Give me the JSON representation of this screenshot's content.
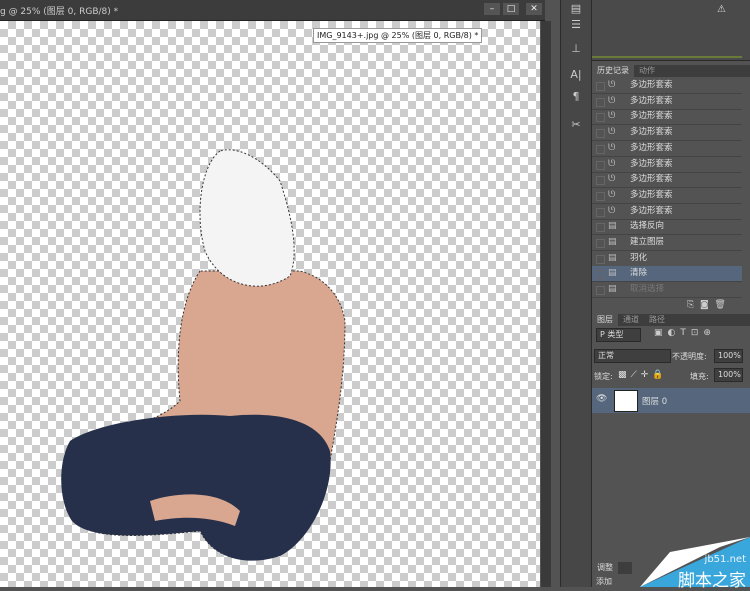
{
  "window": {
    "title": "g @ 25% (图层 0, RGB/8) *",
    "tooltip": "IMG_9143+.jpg @ 25% (图层 0, RGB/8) *",
    "min": "–",
    "max": "□",
    "close": "✕"
  },
  "history": {
    "tabs": [
      "历史记录",
      "动作"
    ],
    "items": [
      {
        "label": "多边形套索",
        "icon": "lasso"
      },
      {
        "label": "多边形套索",
        "icon": "lasso"
      },
      {
        "label": "多边形套索",
        "icon": "lasso"
      },
      {
        "label": "多边形套索",
        "icon": "lasso"
      },
      {
        "label": "多边形套索",
        "icon": "lasso"
      },
      {
        "label": "多边形套索",
        "icon": "lasso"
      },
      {
        "label": "多边形套索",
        "icon": "lasso"
      },
      {
        "label": "多边形套索",
        "icon": "lasso"
      },
      {
        "label": "多边形套索",
        "icon": "lasso"
      },
      {
        "label": "选择反向",
        "icon": "doc"
      },
      {
        "label": "建立图层",
        "icon": "doc"
      },
      {
        "label": "羽化",
        "icon": "doc"
      },
      {
        "label": "清除",
        "icon": "doc",
        "selected": true
      },
      {
        "label": "取消选择",
        "icon": "doc",
        "dimmed": true
      }
    ]
  },
  "layers": {
    "tabs": [
      "图层",
      "通道",
      "路径"
    ],
    "filter": "P 类型",
    "blend": "正常",
    "opacity_label": "不透明度:",
    "opacity": "100%",
    "lock_label": "锁定:",
    "fill_label": "填充:",
    "fill": "100%",
    "layer_name": "图层 0"
  },
  "bottom": {
    "tab": "调整",
    "item": "添加"
  },
  "watermark": {
    "line1": "jb51.net",
    "line2": "脚本之家"
  }
}
